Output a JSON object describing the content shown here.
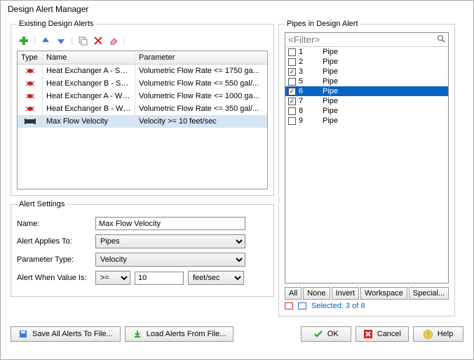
{
  "window": {
    "title": "Design Alert Manager"
  },
  "existing": {
    "legend": "Existing Design Alerts",
    "headers": {
      "type": "Type",
      "name": "Name",
      "param": "Parameter"
    },
    "rows": [
      {
        "name": "Heat Exchanger A - Sum...",
        "param": "Volumetric Flow Rate <= 1750 ga...",
        "selected": false,
        "icon": "bug"
      },
      {
        "name": "Heat Exchanger B - Sum...",
        "param": "Volumetric Flow Rate <= 550 gal/...",
        "selected": false,
        "icon": "bug"
      },
      {
        "name": "Heat Exchanger A - Winter",
        "param": "Volumetric Flow Rate <= 1000 ga...",
        "selected": false,
        "icon": "bug"
      },
      {
        "name": "Heat Exchanger B - Winter",
        "param": "Volumetric Flow Rate <= 350 gal/...",
        "selected": false,
        "icon": "bug"
      },
      {
        "name": "Max Flow Velocity",
        "param": "Velocity >= 10 feet/sec",
        "selected": true,
        "icon": "pipe"
      }
    ]
  },
  "settings": {
    "legend": "Alert Settings",
    "name_label": "Name:",
    "name_value": "Max Flow Velocity",
    "applies_label": "Alert Applies To:",
    "applies_value": "Pipes",
    "ptype_label": "Parameter Type:",
    "ptype_value": "Velocity",
    "when_label": "Alert When Value Is:",
    "op_value": ">=",
    "num_value": "10",
    "unit_value": "feet/sec"
  },
  "pipes": {
    "legend": "Pipes in Design Alert",
    "filter_placeholder": "<Filter>",
    "rows": [
      {
        "num": "1",
        "label": "Pipe",
        "checked": false,
        "sel": false
      },
      {
        "num": "2",
        "label": "Pipe",
        "checked": false,
        "sel": false
      },
      {
        "num": "3",
        "label": "Pipe",
        "checked": true,
        "sel": false
      },
      {
        "num": "5",
        "label": "Pipe",
        "checked": false,
        "sel": false
      },
      {
        "num": "6",
        "label": "Pipe",
        "checked": true,
        "sel": true
      },
      {
        "num": "7",
        "label": "Pipe",
        "checked": true,
        "sel": false
      },
      {
        "num": "8",
        "label": "Pipe",
        "checked": false,
        "sel": false
      },
      {
        "num": "9",
        "label": "Pipe",
        "checked": false,
        "sel": false
      }
    ],
    "buttons": {
      "all": "All",
      "none": "None",
      "invert": "Invert",
      "workspace": "Workspace",
      "special": "Special..."
    },
    "status": "Selected: 3 of 8"
  },
  "bottom": {
    "save": "Save All Alerts To File...",
    "load": "Load Alerts From File...",
    "ok": "OK",
    "cancel": "Cancel",
    "help": "Help"
  }
}
